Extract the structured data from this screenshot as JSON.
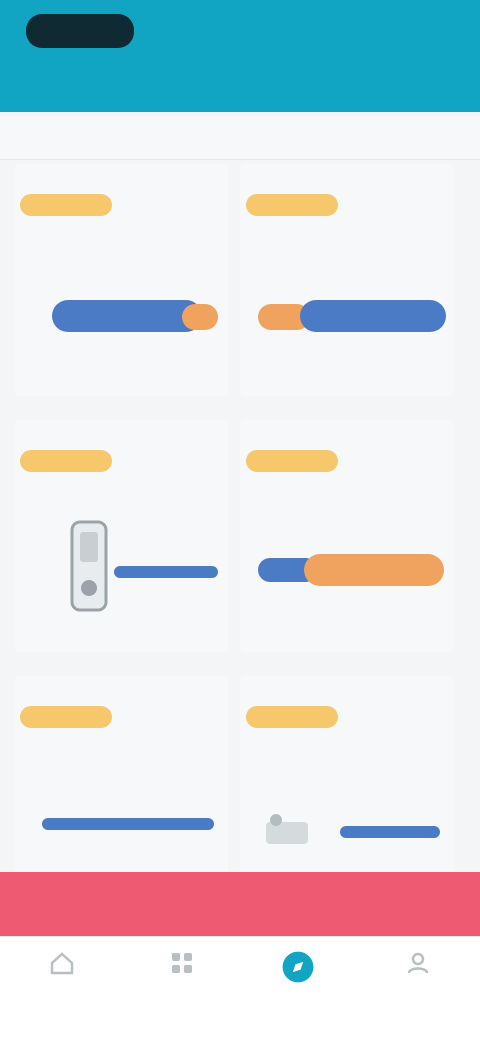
{
  "header": {
    "logo_text": "",
    "action_text": "",
    "subtitle": "",
    "corner_text": ""
  },
  "filter": {
    "text": ""
  },
  "cards": [
    {
      "badge": "",
      "title": "",
      "meta": ""
    },
    {
      "badge": "",
      "title": "",
      "meta": ""
    },
    {
      "badge": "",
      "title": "",
      "meta": ""
    },
    {
      "badge": "",
      "title": "",
      "meta": ""
    },
    {
      "badge": "",
      "title": "",
      "meta": ""
    },
    {
      "badge": "",
      "title": "",
      "meta": ""
    }
  ],
  "banner": {
    "text": ""
  },
  "tabs": [
    {
      "label": "",
      "icon": "home-icon"
    },
    {
      "label": "",
      "icon": "grid-icon"
    },
    {
      "label": "",
      "icon": "compass-icon"
    },
    {
      "label": "",
      "icon": "user-icon"
    }
  ],
  "colors": {
    "header": "#12a4c3",
    "badge": "#f6c86b",
    "bar_blue": "#4c7bc5",
    "bar_orange": "#f0a35e",
    "banner": "#ee5a72"
  }
}
